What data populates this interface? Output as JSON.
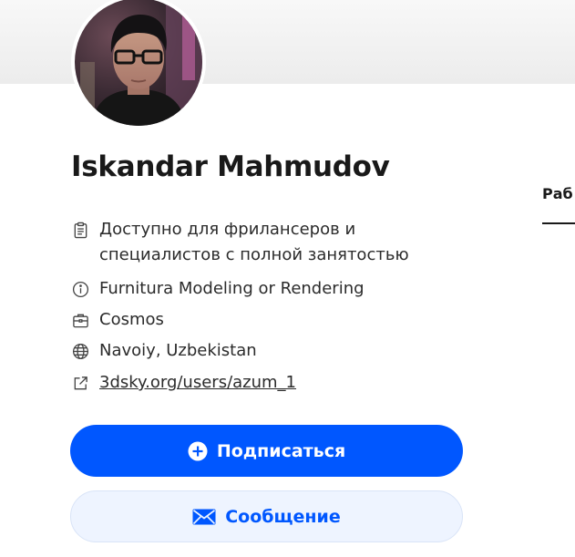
{
  "profile": {
    "name": "Iskandar Mahmudov",
    "availability": "Доступно для фрилансеров и специалистов с полной занятостью",
    "headline": "Furnitura Modeling or Rendering",
    "company": "Cosmos",
    "location": "Navoiy, Uzbekistan",
    "website": "3dsky.org/users/azum_1"
  },
  "actions": {
    "follow_label": "Подписаться",
    "message_label": "Сообщение"
  },
  "tabs": {
    "partial_label": "Раб"
  },
  "icons": {
    "availability": "clipboard-icon",
    "headline": "info-icon",
    "company": "briefcase-icon",
    "location": "globe-icon",
    "website": "external-link-icon",
    "follow": "plus-circle-icon",
    "message": "envelope-icon"
  },
  "colors": {
    "accent": "#0057ff",
    "secondary_bg": "#eef4ff",
    "text": "#191919"
  }
}
